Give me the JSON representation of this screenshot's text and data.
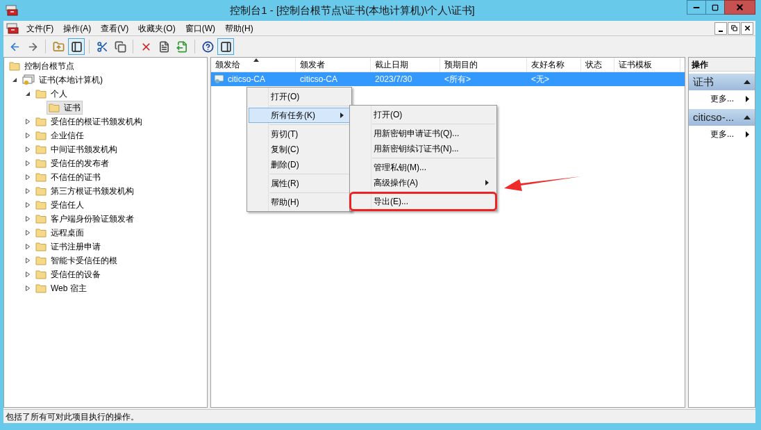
{
  "window": {
    "title": "控制台1 - [控制台根节点\\证书(本地计算机)\\个人\\证书]"
  },
  "menu_bar": [
    "文件(F)",
    "操作(A)",
    "查看(V)",
    "收藏夹(O)",
    "窗口(W)",
    "帮助(H)"
  ],
  "toolbar": [
    {
      "kind": "back",
      "pressed": false
    },
    {
      "kind": "forward",
      "pressed": false
    },
    {
      "kind": "up",
      "pressed": false
    },
    {
      "kind": "tree",
      "pressed": true
    },
    {
      "kind": "cut",
      "pressed": false
    },
    {
      "kind": "copy",
      "pressed": false
    },
    {
      "kind": "delete",
      "pressed": false
    },
    {
      "kind": "properties",
      "pressed": false
    },
    {
      "kind": "export",
      "pressed": false
    },
    {
      "kind": "help",
      "pressed": false
    },
    {
      "kind": "actions",
      "pressed": true
    }
  ],
  "tree": [
    {
      "label": "控制台根节点",
      "kind": "folder",
      "children": [
        {
          "label": "证书(本地计算机)",
          "kind": "store",
          "expanded": true,
          "children": [
            {
              "label": "个人",
              "kind": "folder",
              "expanded": true,
              "children": [
                {
                  "label": "证书",
                  "kind": "folder",
                  "selected": true
                }
              ]
            },
            {
              "label": "受信任的根证书颁发机构",
              "kind": "folder",
              "expanded": false
            },
            {
              "label": "企业信任",
              "kind": "folder",
              "expanded": false
            },
            {
              "label": "中间证书颁发机构",
              "kind": "folder",
              "expanded": false
            },
            {
              "label": "受信任的发布者",
              "kind": "folder",
              "expanded": false
            },
            {
              "label": "不信任的证书",
              "kind": "folder",
              "expanded": false
            },
            {
              "label": "第三方根证书颁发机构",
              "kind": "folder",
              "expanded": false
            },
            {
              "label": "受信任人",
              "kind": "folder",
              "expanded": false
            },
            {
              "label": "客户端身份验证颁发者",
              "kind": "folder",
              "expanded": false
            },
            {
              "label": "远程桌面",
              "kind": "folder",
              "expanded": false
            },
            {
              "label": "证书注册申请",
              "kind": "folder",
              "expanded": false
            },
            {
              "label": "智能卡受信任的根",
              "kind": "folder",
              "expanded": false
            },
            {
              "label": "受信任的设备",
              "kind": "folder",
              "expanded": false
            },
            {
              "label": "Web 宿主",
              "kind": "folder",
              "expanded": false
            }
          ]
        }
      ]
    }
  ],
  "table": {
    "columns": [
      {
        "label": "颁发给",
        "sorted": true
      },
      {
        "label": "颁发者",
        "sorted": false
      },
      {
        "label": "截止日期",
        "sorted": false
      },
      {
        "label": "预期目的",
        "sorted": false
      },
      {
        "label": "友好名称",
        "sorted": false
      },
      {
        "label": "状态",
        "sorted": false
      },
      {
        "label": "证书模板",
        "sorted": false
      }
    ],
    "rows": [
      {
        "selected": true,
        "cells": [
          "citicso-CA",
          "citicso-CA",
          "2023/7/30",
          "<所有>",
          "<无>",
          "",
          ""
        ]
      }
    ]
  },
  "context_menu": {
    "items": [
      {
        "kind": "item",
        "label": "打开(O)",
        "selected": false,
        "submenu": false
      },
      {
        "kind": "separator"
      },
      {
        "kind": "item",
        "label": "所有任务(K)",
        "selected": true,
        "submenu": true
      },
      {
        "kind": "separator"
      },
      {
        "kind": "item",
        "label": "剪切(T)",
        "selected": false,
        "submenu": false
      },
      {
        "kind": "item",
        "label": "复制(C)",
        "selected": false,
        "submenu": false
      },
      {
        "kind": "item",
        "label": "删除(D)",
        "selected": false,
        "submenu": false
      },
      {
        "kind": "separator"
      },
      {
        "kind": "item",
        "label": "属性(R)",
        "selected": false,
        "submenu": false
      },
      {
        "kind": "separator"
      },
      {
        "kind": "item",
        "label": "帮助(H)",
        "selected": false,
        "submenu": false
      }
    ],
    "submenu": [
      {
        "kind": "item",
        "label": "打开(O)",
        "submenu": false,
        "marked": false
      },
      {
        "kind": "separator"
      },
      {
        "kind": "item",
        "label": "用新密钥申请证书(Q)...",
        "submenu": false,
        "marked": false
      },
      {
        "kind": "item",
        "label": "用新密钥续订证书(N)...",
        "submenu": false,
        "marked": false
      },
      {
        "kind": "separator"
      },
      {
        "kind": "item",
        "label": "管理私钥(M)...",
        "submenu": false,
        "marked": false
      },
      {
        "kind": "item",
        "label": "高级操作(A)",
        "submenu": true,
        "marked": false
      },
      {
        "kind": "separator"
      },
      {
        "kind": "item",
        "label": "导出(E)...",
        "submenu": false,
        "marked": true
      }
    ]
  },
  "action_pane": {
    "title": "操作",
    "sections": [
      {
        "title": "证书",
        "expanded": true,
        "items": [
          "更多..."
        ]
      },
      {
        "title": "citicso-...",
        "expanded": true,
        "items": [
          "更多..."
        ]
      }
    ]
  },
  "status_bar": "包括了所有可对此项目执行的操作。"
}
